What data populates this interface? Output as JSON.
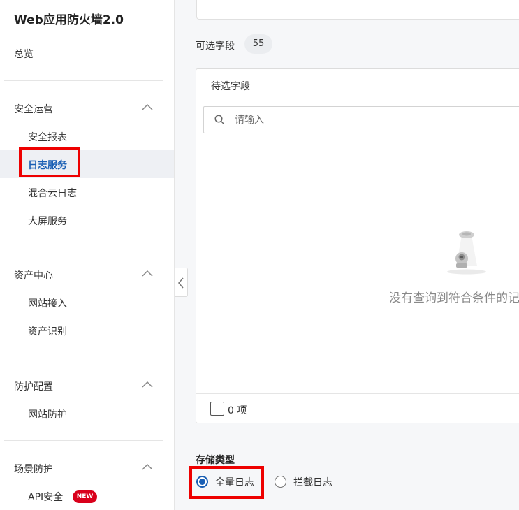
{
  "sidebar": {
    "app_title": "Web应用防火墙2.0",
    "overview": "总览",
    "groups": [
      {
        "title": "安全运营",
        "items": [
          "安全报表",
          "日志服务",
          "混合云日志",
          "大屏服务"
        ],
        "active": "日志服务"
      },
      {
        "title": "资产中心",
        "items": [
          "网站接入",
          "资产识别"
        ]
      },
      {
        "title": "防护配置",
        "items": [
          "网站防护"
        ]
      },
      {
        "title": "场景防护",
        "items": [
          "API安全"
        ],
        "badge": "NEW"
      }
    ]
  },
  "main": {
    "optional_fields_label": "可选字段",
    "optional_fields_count": "55",
    "panel_title": "待选字段",
    "search_placeholder": "请输入",
    "empty_text": "没有查询到符合条件的记录",
    "selected_count": "0 项",
    "storage_type_title": "存储类型",
    "storage_options": [
      {
        "label": "全量日志",
        "checked": true
      },
      {
        "label": "拦截日志",
        "checked": false
      }
    ]
  },
  "colors": {
    "accent": "#1a5fb4",
    "highlight_box": "#ee0000",
    "badge": "#d9001b"
  }
}
